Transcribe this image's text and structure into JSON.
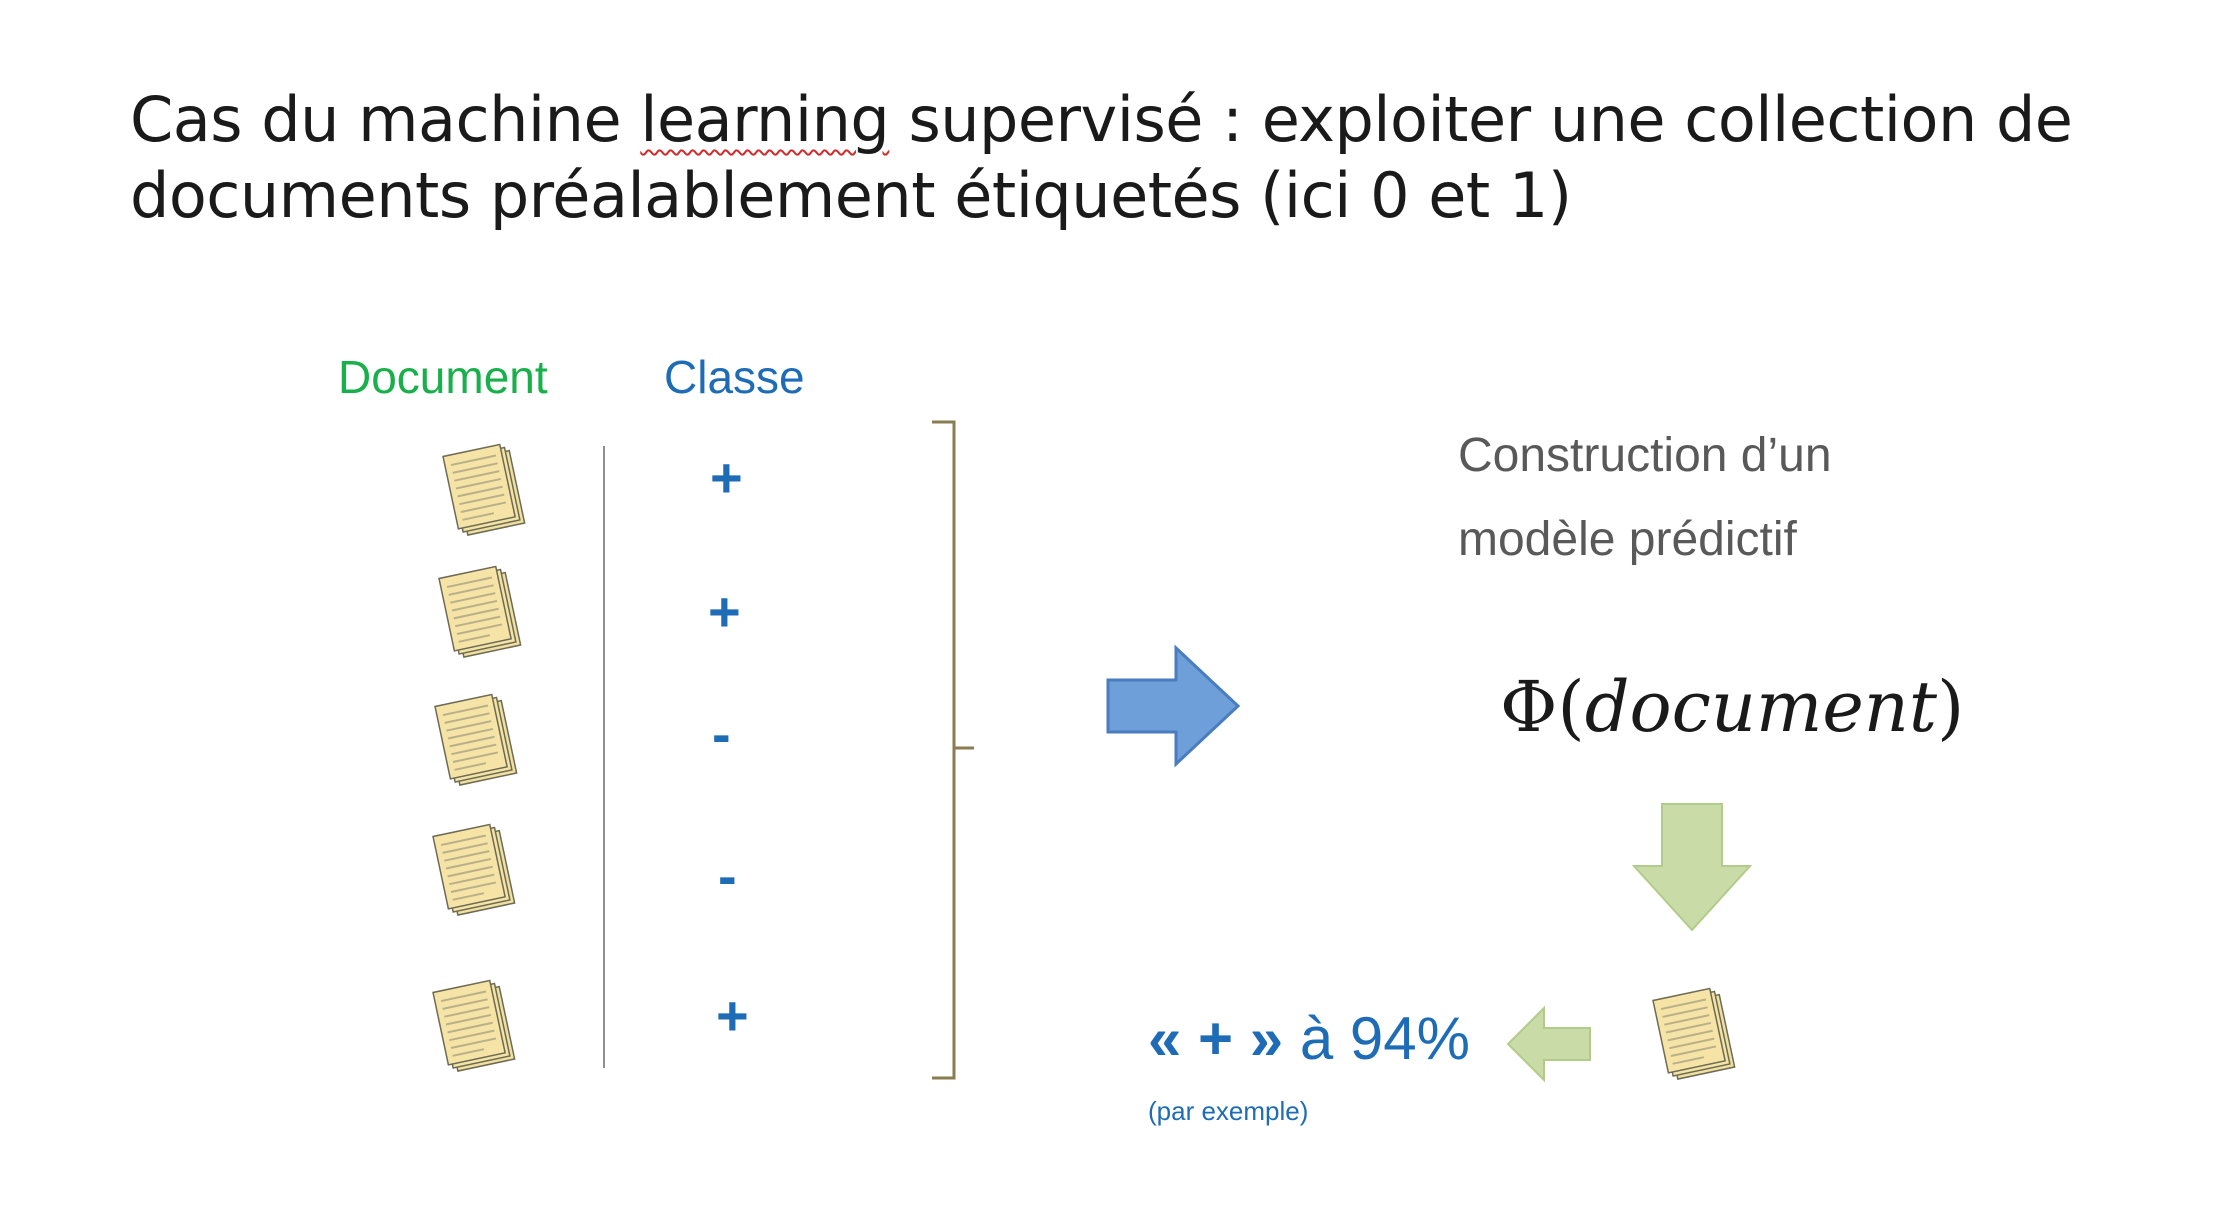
{
  "title": {
    "line1_before": "Cas du machine ",
    "line1_flagged": "learning",
    "line1_after": " supervisé : exploiter une collection de",
    "line2": "documents préalablement étiquetés (ici 0 et 1)"
  },
  "table": {
    "document_header": "Document",
    "class_header": "Classe",
    "rows": [
      {
        "class": "+"
      },
      {
        "class": "+"
      },
      {
        "class": "-"
      },
      {
        "class": "-"
      },
      {
        "class": "+"
      }
    ]
  },
  "model": {
    "construction_line1": "Construction d’un",
    "construction_line2": "modèle prédictif",
    "phi_symbol": "Φ",
    "phi_open": "(",
    "phi_arg": "document",
    "phi_close": ")"
  },
  "result": {
    "quote_open": "«",
    "label": "+",
    "quote_close": "»",
    "text": "à 94%",
    "note": "(par exemple)"
  },
  "icons": {
    "document": "document-stack-icon",
    "arrow_right": "arrow-right-icon",
    "arrow_down": "arrow-down-icon",
    "arrow_left": "arrow-left-icon",
    "bracket": "right-brace"
  },
  "colors": {
    "document_header": "#18b04a",
    "class_header": "#1f6cb6",
    "class_symbol": "#1f6cb6",
    "arrow_blue": "#6f9fd8",
    "arrow_green": "#c9dba7",
    "brace": "#8a7d52",
    "document_fill": "#f6e4a6"
  }
}
